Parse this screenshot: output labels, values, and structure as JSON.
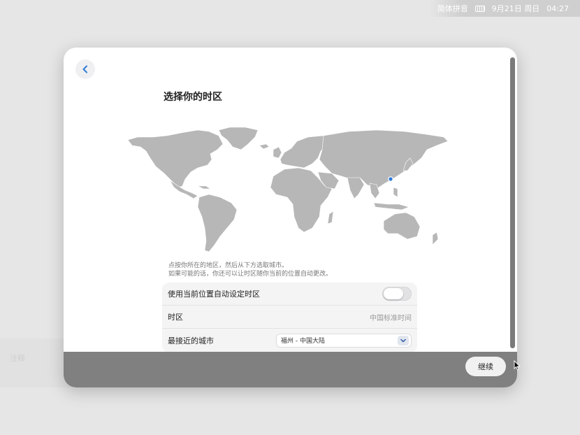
{
  "menubar": {
    "input_method": "简体拼音",
    "keyboard_icon": "keyboard-icon",
    "date": "9月21日 周日",
    "time": "04:27"
  },
  "ghost_panel": {
    "text": "注释"
  },
  "window": {
    "back_icon": "chevron-left-icon",
    "title": "选择你的时区",
    "map": {
      "selected_city": "福州",
      "marker_color": "#2f7bd6",
      "land_color": "#b7b7b7"
    },
    "hint_lines": [
      "点按你所在的地区，然后从下方选取城市。",
      "如果可能的话，你还可以让时区随你当前的位置自动更改。"
    ],
    "settings": {
      "auto_timezone_label": "使用当前位置自动设定时区",
      "auto_timezone_on": false,
      "timezone_label": "时区",
      "timezone_value": "中国标准时间",
      "nearest_city_label": "最接近的城市",
      "nearest_city_value": "福州 - 中国大陆"
    },
    "continue_label": "继续"
  },
  "colors": {
    "accent": "#2f7bd6",
    "footer": "#808080",
    "background": "#e6e6e6"
  }
}
